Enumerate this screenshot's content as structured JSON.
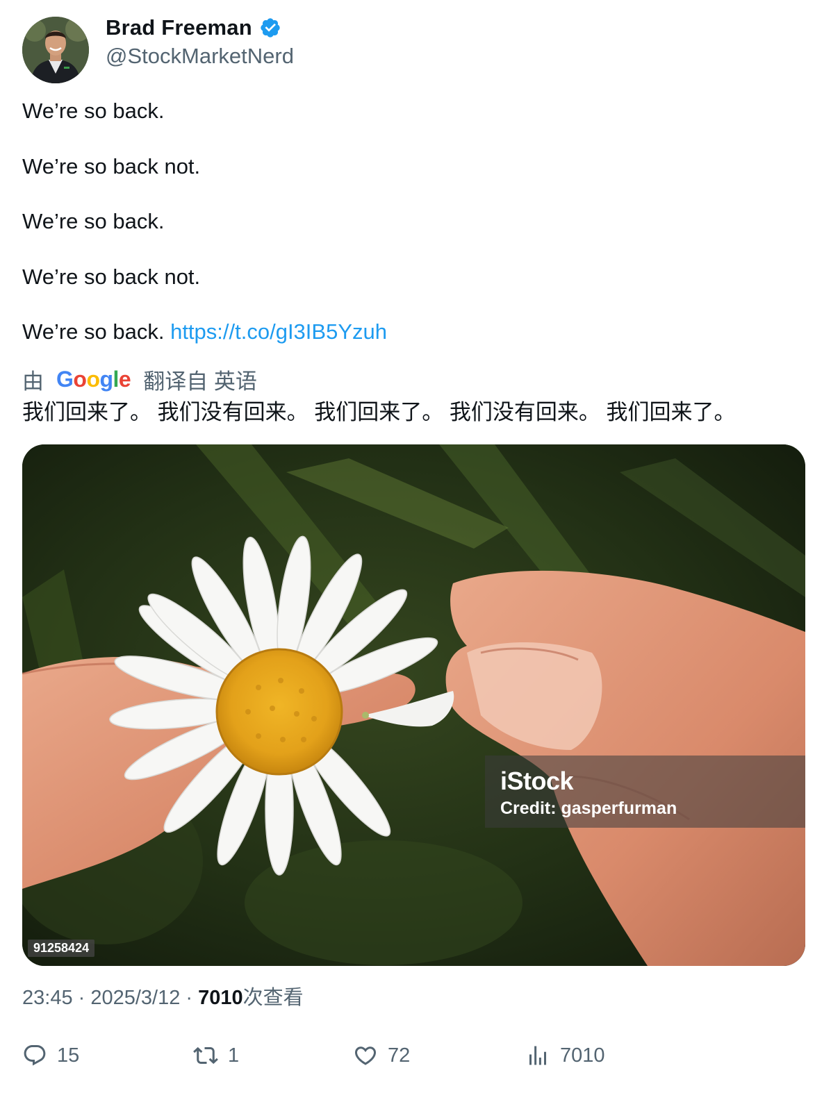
{
  "author": {
    "display_name": "Brad Freeman",
    "handle": "@StockMarketNerd",
    "verified_icon": "verified-badge-icon",
    "verified_color": "#1d9bf0"
  },
  "tweet": {
    "lines": [
      "We’re so back.",
      "We’re so back not.",
      "We’re so back.",
      "We’re so back not.",
      "We’re so back."
    ],
    "link": "https://t.co/gI3IB5Yzuh"
  },
  "translation": {
    "prefix": "由",
    "provider": "Google",
    "suffix": "翻译自 英语",
    "text": "我们回来了。 我们没有回来。 我们回来了。 我们没有回来。 我们回来了。"
  },
  "media": {
    "watermark_brand": "iStock",
    "watermark_credit": "Credit: gasperfurman",
    "stock_id": "91258424"
  },
  "meta": {
    "time": "23:45",
    "separator": " · ",
    "date": "2025/3/12",
    "views_count": "7010",
    "views_label": "次查看"
  },
  "actions": {
    "replies": "15",
    "retweets": "1",
    "likes": "72",
    "views": "7010"
  },
  "colors": {
    "text_primary": "#0f1419",
    "text_secondary": "#536471",
    "link": "#1d9bf0"
  }
}
